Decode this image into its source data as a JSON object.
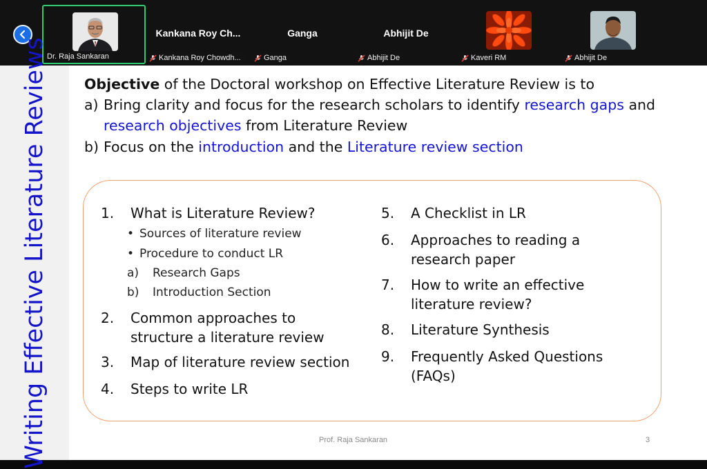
{
  "meeting": {
    "participants": [
      {
        "display_name": "",
        "tag_name": "Dr. Raja Sankaran",
        "muted": false,
        "video": "photo-man-glasses",
        "active": true
      },
      {
        "display_name": "Kankana  Roy  Ch...",
        "tag_name": "Kankana Roy Chowdh...",
        "muted": true
      },
      {
        "display_name": "Ganga",
        "tag_name": "Ganga",
        "muted": true
      },
      {
        "display_name": "Abhijit De",
        "tag_name": "Abhijit De",
        "muted": true
      },
      {
        "display_name": "",
        "tag_name": "Kaveri RM",
        "muted": true,
        "video": "photo-orange-flower"
      },
      {
        "display_name": "",
        "tag_name": "Abhijit De",
        "muted": true,
        "video": "photo-man"
      }
    ],
    "colors": {
      "active_border": "#2ecc71",
      "back_button": "#1c6ee6"
    }
  },
  "slide": {
    "side_title": "Writing Effective Literature Reviews",
    "objective": {
      "line1_bold": "Objective",
      "line1_rest": " of the Doctoral workshop on Effective Literature Review is to",
      "a_label": "a)",
      "a_text1": "Bring clarity and focus for the research scholars to identify ",
      "a_link1": "research gaps",
      "a_text2": " and",
      "a_link2": "research objectives",
      "a_text3": " from Literature Review",
      "b_label": "b)",
      "b_text1": "Focus on the ",
      "b_link1": "introduction",
      "b_text2": " and the ",
      "b_link2": "Literature review section"
    },
    "left_items": [
      {
        "num": "1.",
        "text": "What is Literature Review?"
      },
      {
        "num": "2.",
        "text_line1": "Common approaches to",
        "text_line2": "structure a literature review"
      },
      {
        "num": "3.",
        "text": "Map of literature review section"
      },
      {
        "num": "4.",
        "text": "Steps to write LR"
      }
    ],
    "sub_items": [
      {
        "marker": "•",
        "text": "Sources of literature review"
      },
      {
        "marker": "•",
        "text": "Procedure to conduct LR"
      },
      {
        "marker": "a)",
        "text": "Research Gaps"
      },
      {
        "marker": "b)",
        "text": "Introduction Section"
      }
    ],
    "right_items": [
      {
        "num": "5.",
        "text_line1": "A Checklist in LR"
      },
      {
        "num": "6.",
        "text_line1": "Approaches to reading a",
        "text_line2": "research paper"
      },
      {
        "num": "7.",
        "text_line1": "How to write an effective",
        "text_line2": "literature review?"
      },
      {
        "num": "8.",
        "text_line1": "Literature Synthesis"
      },
      {
        "num": "9.",
        "text_line1": "Frequently Asked Questions",
        "text_line2": "(FAQs)"
      }
    ],
    "footer_author": "Prof. Raja Sankaran",
    "page_number": "3",
    "colors": {
      "title_blue": "#1414c8",
      "link_blue": "#1414d4",
      "box_border": "#f0a070"
    }
  }
}
